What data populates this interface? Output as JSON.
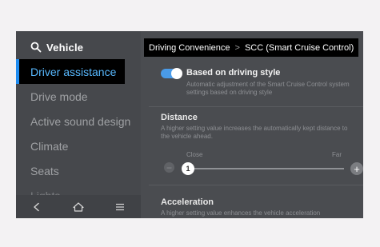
{
  "header": {
    "title": "Vehicle"
  },
  "sidebar": {
    "items": [
      {
        "label": "Driver assistance"
      },
      {
        "label": "Drive mode"
      },
      {
        "label": "Active sound design"
      },
      {
        "label": "Climate"
      },
      {
        "label": "Seats"
      },
      {
        "label": "Lights"
      }
    ]
  },
  "breadcrumb": {
    "parent": "Driving Convenience",
    "separator": ">",
    "current": "SCC (Smart Cruise Control)"
  },
  "settings": {
    "driving_style": {
      "title": "Based on driving style",
      "description": "Automatic adjustment of the Smart Cruise Control system settings based on driving style",
      "enabled": true
    },
    "distance": {
      "title": "Distance",
      "description": "A higher setting value increases the automatically kept distance to the vehicle ahead.",
      "min_label": "Close",
      "max_label": "Far",
      "value": "1",
      "minus": "−",
      "plus": "+"
    },
    "acceleration": {
      "title": "Acceleration",
      "description": "A higher setting value enhances the vehicle acceleration"
    }
  },
  "colors": {
    "accent": "#1e8cf0",
    "active_text": "#58b9ff",
    "toggle_on": "#4a9be8"
  },
  "icons": {
    "search": "search-icon",
    "back": "back-icon",
    "home": "home-icon",
    "menu": "menu-icon"
  }
}
